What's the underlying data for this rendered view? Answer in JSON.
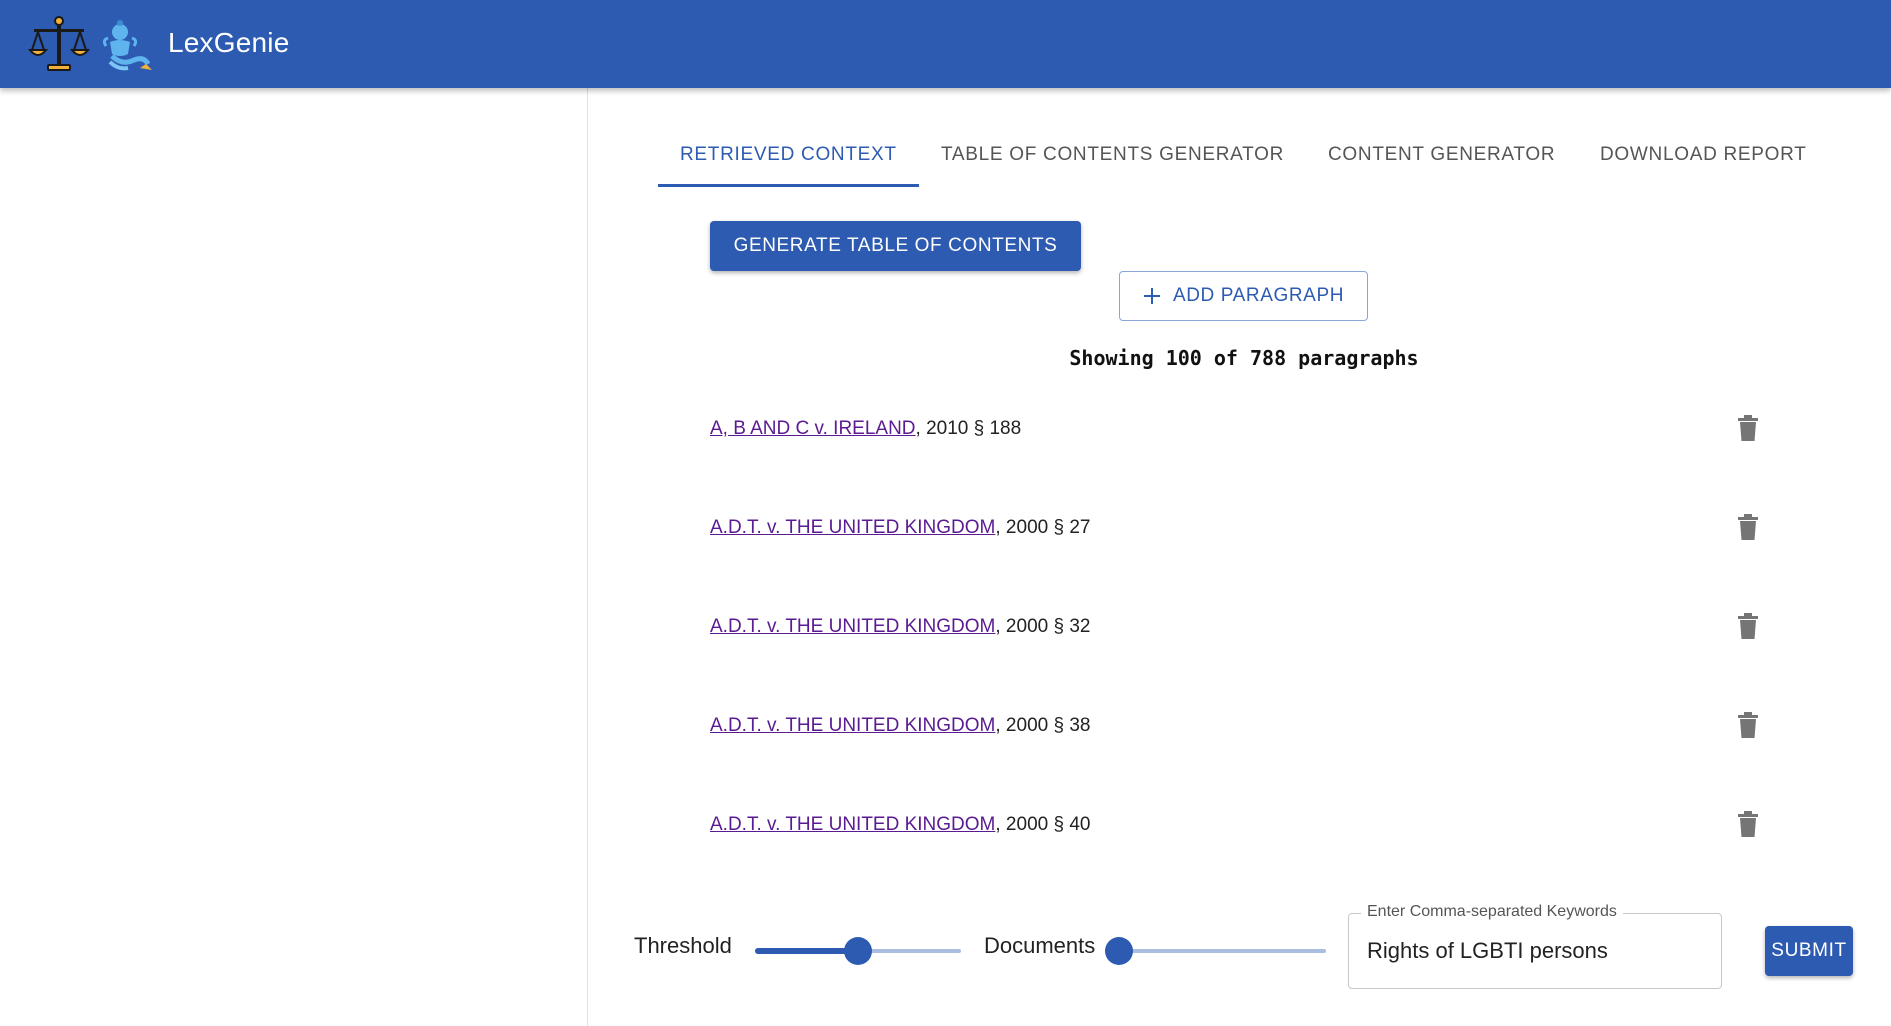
{
  "app": {
    "title": "LexGenie",
    "logo_icons": [
      "scales-of-justice-icon",
      "genie-icon"
    ],
    "brand_color": "#2c5bb1"
  },
  "tabs": [
    {
      "label": "RETRIEVED CONTEXT",
      "active": true
    },
    {
      "label": "TABLE OF CONTENTS GENERATOR",
      "active": false
    },
    {
      "label": "CONTENT GENERATOR",
      "active": false
    },
    {
      "label": "DOWNLOAD REPORT",
      "active": false
    }
  ],
  "actions": {
    "generate_toc_label": "GENERATE TABLE OF CONTENTS",
    "add_paragraph_label": "ADD PARAGRAPH",
    "add_icon": "plus-icon"
  },
  "status": {
    "showing_text": "Showing 100 of 788 paragraphs"
  },
  "paragraphs": [
    {
      "case": "A, B AND C v. IRELAND",
      "suffix": ", 2010 § 188"
    },
    {
      "case": "A.D.T. v. THE UNITED KINGDOM",
      "suffix": ", 2000 § 27"
    },
    {
      "case": "A.D.T. v. THE UNITED KINGDOM",
      "suffix": ", 2000 § 32"
    },
    {
      "case": "A.D.T. v. THE UNITED KINGDOM",
      "suffix": ", 2000 § 38"
    },
    {
      "case": "A.D.T. v. THE UNITED KINGDOM",
      "suffix": ", 2000 § 40"
    }
  ],
  "controls": {
    "threshold_label": "Threshold",
    "threshold_value": 0.5,
    "documents_label": "Documents",
    "documents_value": 0,
    "keywords_label": "Enter Comma-separated Keywords",
    "keywords_value": "Rights of LGBTI persons",
    "submit_label": "SUBMIT"
  }
}
